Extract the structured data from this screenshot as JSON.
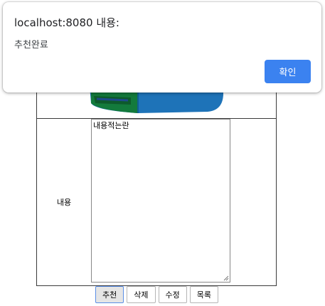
{
  "dialog": {
    "title": "localhost:8080 내용:",
    "message": "추천완료",
    "ok_label": "확인",
    "ok_color": "#3b82f0"
  },
  "form": {
    "content_label": "내용",
    "content_value": "내용적는란"
  },
  "buttons": {
    "recommend": "추천",
    "delete": "삭제",
    "edit": "수정",
    "list": "목록"
  }
}
